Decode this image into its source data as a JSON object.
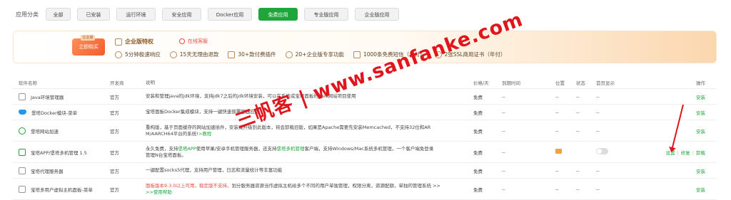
{
  "categories": {
    "label": "应用分类",
    "items": [
      "全部",
      "已安装",
      "运行环境",
      "安全应用",
      "Docker应用",
      "免费应用",
      "专业版应用",
      "企业版应用"
    ],
    "active": "免费应用"
  },
  "banner": {
    "badge_top": "企业版",
    "badge": "立即购买",
    "title": "企业版特权",
    "service": "在线客服",
    "features": [
      "5分钟极速响应",
      "15天无理由退款",
      "30+款付费插件",
      "20+企业版专享功能",
      "1000条免费短信（年付）",
      "2张SSL商用证书（年付）"
    ]
  },
  "table": {
    "headers": {
      "name": "软件名称",
      "developer": "开发商",
      "description": "说明",
      "price": "价格/天",
      "expiry": "到期时间",
      "position": "位置",
      "state": "状态",
      "home": "首页显示",
      "ops": "操作"
    },
    "rows": [
      {
        "name": "Java环境管理器",
        "developer": "官方",
        "desc": "安装和管理java的jdk环境，支持jdk7之后的jdk环境安装，可以在系统或宝塔面板的Java网站项目使用",
        "price": "免费",
        "expiry": "--",
        "position": "--",
        "state": "--",
        "home": "--",
        "op": "安装"
      },
      {
        "name": "堡塔Docker模块-菜单",
        "developer": "官方",
        "desc": "宝塔面板Docker集成模块，支持一键快速部署容器应用",
        "price": "免费",
        "expiry": "--",
        "position": "--",
        "state": "--",
        "home": "--",
        "op": "安装"
      },
      {
        "name": "堡塔网站加速",
        "developer": "官方",
        "desc1": "重构版，基于页面缓存的网站加速插件，安装或升级到此版本，将会卸载旧版，如果是Apache需要先安装Memcached，不支持32位和AR",
        "desc2": "M/AARCH64平台的系统!",
        "desc_link": ">教程",
        "price": "免费",
        "expiry": "--",
        "position": "--",
        "state": "--",
        "home": "--",
        "op": "安装"
      },
      {
        "name": "宝塔APP/堡塔多机管理 1.5",
        "developer": "官方",
        "desc_a": "永久免费，支持",
        "desc_l1": "堡塔APP",
        "desc_b": "使用苹果/安卓手机管理服务器，还支持",
        "desc_l2": "堡塔多机管理",
        "desc_c": "客户端，支持Windows/Mac系统多机管理，一个客户端免登录",
        "desc2": "管理N台宝塔面板。",
        "price": "免费",
        "expiry": "--",
        "ops": [
          "设置",
          "修复",
          "卸载"
        ]
      },
      {
        "name": "宝塔代理服务器",
        "developer": "官方",
        "desc": "一键配置socks5代理，支持用户管理，日志和流量统计等丰富功能",
        "price": "免费",
        "expiry": "--",
        "position": "--",
        "state": "--",
        "home": "--",
        "op": "安装"
      },
      {
        "name": "宝塔多用户虚拟主机面板-菜单",
        "developer": "官方",
        "desc_red": "面板版本9.3.0以上可用，稳定版不支持，",
        "desc_rest": "划分服务器资源当作虚拟主机给多个不同的用户单独管理，权限分离，资源配额，单独的管理系统 >>",
        "desc_link": ">>使用帮助",
        "price": "免费",
        "expiry": "--",
        "position": "--",
        "state": "--",
        "home": "--",
        "op": "安装"
      }
    ]
  },
  "watermark": "三帆客 | www.sanfanke.com",
  "colors": {
    "accent": "#20a53a",
    "warning": "#e84b3c",
    "watermark": "#e0161c"
  }
}
